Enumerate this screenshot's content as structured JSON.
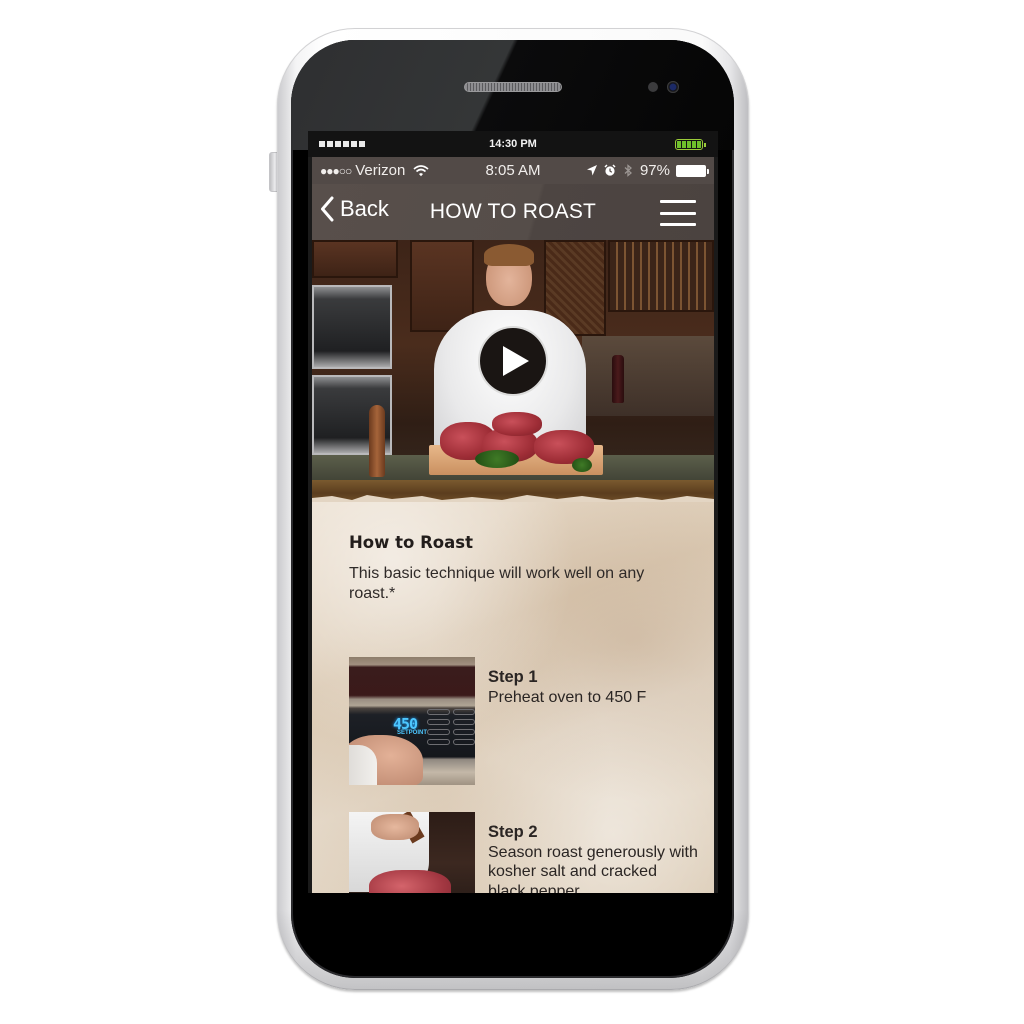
{
  "device": {
    "system_bar": {
      "signal_blocks": 6,
      "time": "14:30 PM",
      "battery_color": "#6fc12b"
    }
  },
  "status_bar": {
    "signal_dots": "●●●○○",
    "carrier": "Verizon",
    "time": "8:05 AM",
    "battery": "97%",
    "icons": [
      "location-arrow-icon",
      "alarm-clock-icon",
      "bluetooth-icon",
      "battery-icon"
    ]
  },
  "nav": {
    "back_label": "Back",
    "title": "HOW TO ROAST",
    "menu_icon": "hamburger-menu-icon"
  },
  "hero": {
    "description": "Chef presenting roast cuts on a cutting board in a kitchen",
    "play_icon": "play-icon"
  },
  "content": {
    "title": "How to Roast",
    "description": "This basic technique will work well on any roast.*",
    "steps": [
      {
        "label": "Step 1",
        "text": "Preheat oven to 450 F",
        "image": "Hand pressing oven control panel",
        "display_value": "450",
        "display_caption": "SETPOINT"
      },
      {
        "label": "Step 2",
        "text": "Season roast generously with kosher salt and cracked black pepper",
        "image": "Chef seasoning rib roast with pepper mill"
      }
    ]
  },
  "colors": {
    "nav_bg": "#524a47",
    "paper_bg": "#e2d4c2",
    "text_dark": "#2b2624"
  }
}
